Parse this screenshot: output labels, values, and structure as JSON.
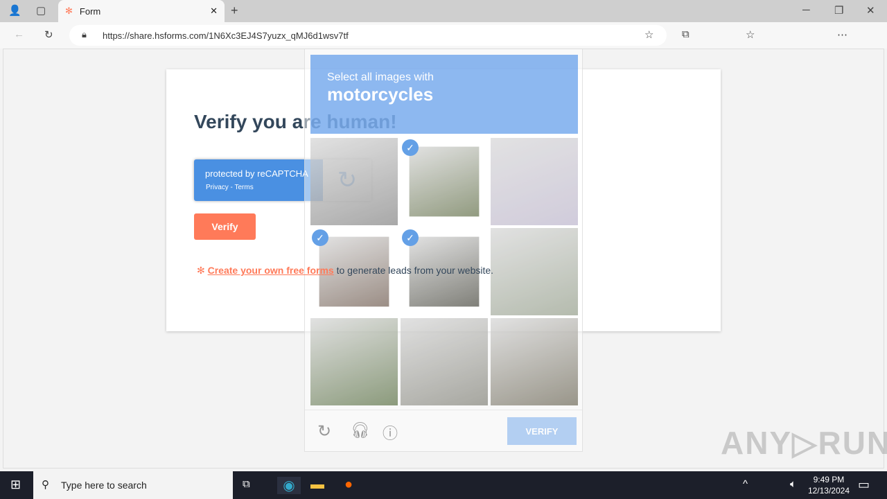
{
  "browser": {
    "tab_title": "Form",
    "url": "https://share.hsforms.com/1N6Xc3EJ4S7yuzx_qMJ6d1wsv7tf"
  },
  "form": {
    "title": "Verify you are human!",
    "recaptcha_line1": "protected by reCAPTCHA",
    "recaptcha_line2": "Privacy - Terms",
    "verify_label": "Verify",
    "hs_link": "Create your own free forms",
    "hs_tail": " to generate leads from your website."
  },
  "captcha": {
    "instruction": "Select all images with",
    "target": "motorcycles",
    "verify_label": "VERIFY",
    "tiles": [
      {
        "selected": false,
        "color": "#9a9a9a"
      },
      {
        "selected": true,
        "color": "#7f8a6a"
      },
      {
        "selected": false,
        "color": "#c9c3d6"
      },
      {
        "selected": true,
        "color": "#8a7a70"
      },
      {
        "selected": true,
        "color": "#6a6a62"
      },
      {
        "selected": false,
        "color": "#a8b0a0"
      },
      {
        "selected": false,
        "color": "#7a8c68"
      },
      {
        "selected": false,
        "color": "#9a9a92"
      },
      {
        "selected": false,
        "color": "#8a8678"
      }
    ]
  },
  "taskbar": {
    "search_placeholder": "Type here to search",
    "time": "9:49 PM",
    "date": "12/13/2024"
  },
  "watermark": "ANY RUN"
}
